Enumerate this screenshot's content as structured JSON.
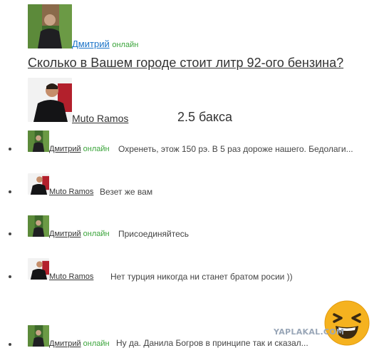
{
  "post": {
    "author_name": "Дмитрий",
    "author_status": "онлайн",
    "title": "Сколько в Вашем городе стоит литр 92-ого бензина?"
  },
  "answer": {
    "author_name": "Muto Ramos",
    "text": "2.5 бакса"
  },
  "comments": [
    {
      "author": "Дмитрий",
      "status": "онлайн",
      "text": "Охренеть, этож 150 рэ. В 5 раз дороже нашего. Бедолаги..."
    },
    {
      "author": "Muto Ramos",
      "status": "",
      "text": "Везет же вам"
    },
    {
      "author": "Дмитрий",
      "status": "онлайн",
      "text": "Присоединяйтесь"
    },
    {
      "author": "Muto Ramos",
      "status": "",
      "text": "Нет турция никогда ни станет братом росии ))"
    },
    {
      "author": "Дмитрий",
      "status": "онлайн",
      "text": "Ну да. Данила Богров в принципе так и сказал..."
    }
  ],
  "watermark": {
    "text": "YAPLAKAL.COM"
  },
  "colors": {
    "link_blue": "#1a73c8",
    "online_green": "#3aa43a",
    "emoji_yellow": "#f5b21f"
  },
  "icons": {
    "dmitry_avatar": "avatar-photo-dark-jacket-foliage",
    "muto_avatar": "avatar-photo-man-dark-red-background",
    "laughing_emoji": "laughing-face-icon"
  }
}
